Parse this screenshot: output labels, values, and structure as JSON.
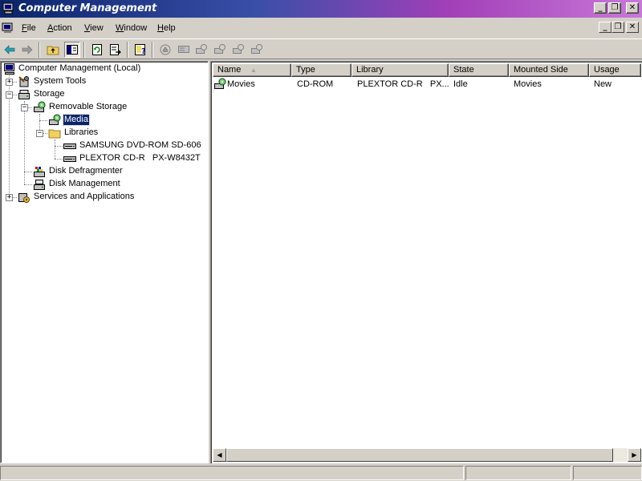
{
  "window": {
    "title": "Computer Management",
    "caption_buttons": {
      "minimize": "_",
      "restore": "❐",
      "close": "✕"
    }
  },
  "menubar": {
    "items": [
      {
        "accel": "F",
        "rest": "ile"
      },
      {
        "accel": "A",
        "rest": "ction"
      },
      {
        "accel": "V",
        "rest": "iew"
      },
      {
        "accel": "W",
        "rest": "indow"
      },
      {
        "accel": "H",
        "rest": "elp"
      }
    ],
    "mdi_buttons": {
      "minimize": "_",
      "restore": "❐",
      "close": "✕"
    }
  },
  "toolbar": {
    "icons": [
      "back-arrow-icon",
      "forward-arrow-icon",
      "up-folder-icon",
      "show-tree-icon",
      "refresh-icon",
      "export-list-icon",
      "help-icon",
      "eject-icon",
      "mount-icon",
      "media-op-icon"
    ]
  },
  "tree": {
    "root": "Computer Management (Local)",
    "system_tools": "System Tools",
    "storage": "Storage",
    "removable_storage": "Removable Storage",
    "media": "Media",
    "libraries": "Libraries",
    "lib_dvd": "SAMSUNG DVD-ROM SD-606",
    "lib_cdr": "PLEXTOR CD-R   PX-W8432T",
    "defrag": "Disk Defragmenter",
    "disk_mgmt": "Disk Management",
    "services": "Services and Applications",
    "expander_plus": "+",
    "expander_minus": "−"
  },
  "list": {
    "columns": [
      "Name",
      "Type",
      "Library",
      "State",
      "Mounted Side",
      "Usage"
    ],
    "sort_indicator": "▲",
    "rows": [
      {
        "name": "Movies",
        "type": "CD-ROM",
        "library": "PLEXTOR CD-R   PX...",
        "state": "Idle",
        "mounted_side": "Movies",
        "usage": "New"
      }
    ]
  },
  "scrollbar": {
    "left": "◀",
    "right": "▶"
  },
  "status": {
    "panels": [
      "",
      "",
      ""
    ]
  },
  "colors": {
    "selection": "#0a246a",
    "face": "#d4d0c8"
  }
}
